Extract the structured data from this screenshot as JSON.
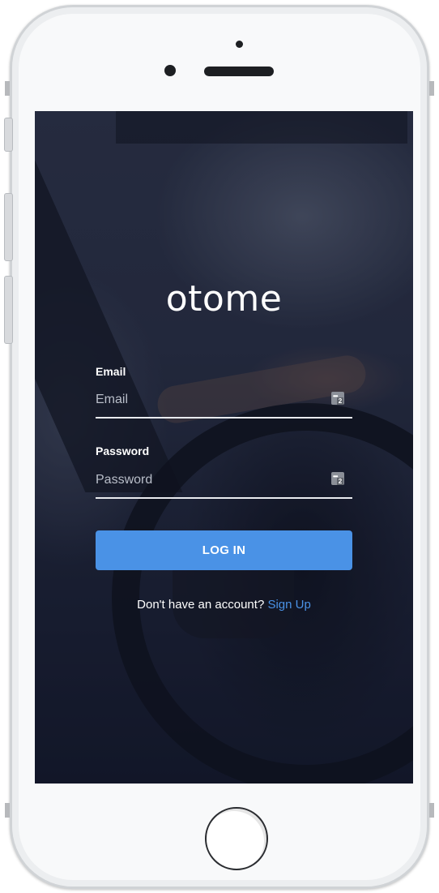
{
  "app": {
    "logo_text": "otome"
  },
  "login_form": {
    "email_label": "Email",
    "email_placeholder": "Email",
    "email_value": "",
    "password_label": "Password",
    "password_placeholder": "Password",
    "password_value": "",
    "autofill_icon_badge": "2",
    "login_button_label": "LOG IN"
  },
  "signup": {
    "prompt_text": "Don't have an account?",
    "link_text": "Sign Up"
  },
  "colors": {
    "accent": "#4a92e6",
    "screen_background": "#1e2333",
    "text": "#ffffff"
  },
  "icons": {
    "autofill": "password-autofill-icon",
    "home": "home-button"
  }
}
